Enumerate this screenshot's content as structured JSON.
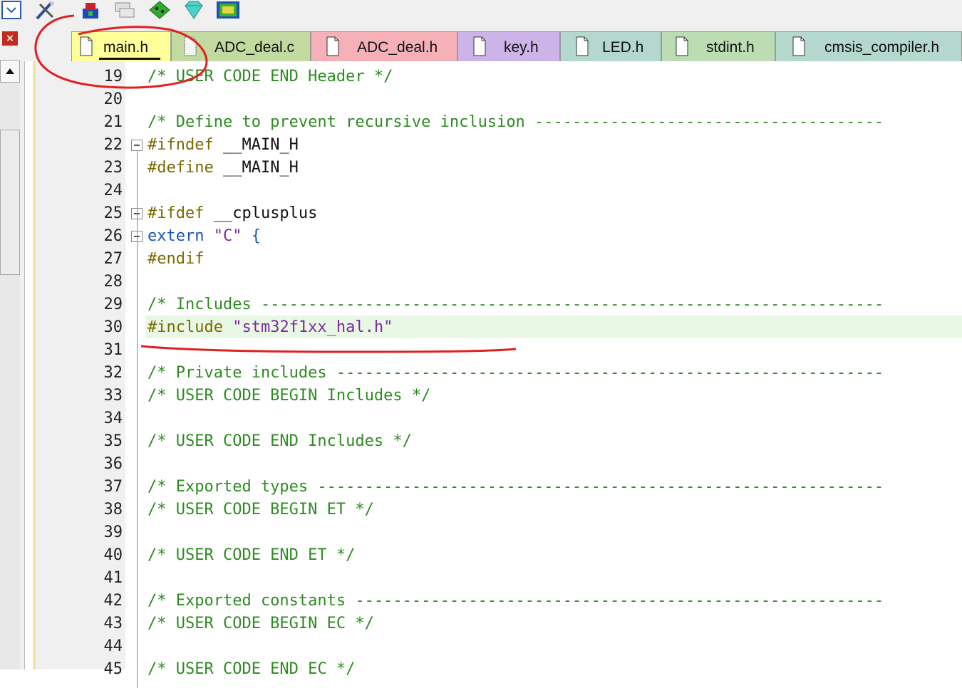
{
  "toolbar": {
    "icons": [
      "dropdown-arrow-icon",
      "magic-wand-icon",
      "build-target-icon",
      "stacked-windows-icon",
      "green-gem-icon",
      "diamond-icon",
      "chip-icon"
    ]
  },
  "left_pane": {
    "close_glyph": "×"
  },
  "tabs": [
    {
      "label": "main.h",
      "color": "#ffff99",
      "active": true
    },
    {
      "label": "ADC_deal.c",
      "color": "#c2d9a0"
    },
    {
      "label": "ADC_deal.h",
      "color": "#f5b0b8"
    },
    {
      "label": "key.h",
      "color": "#cdb4e8"
    },
    {
      "label": "LED.h",
      "color": "#b4d8cd"
    },
    {
      "label": "stdint.h",
      "color": "#bcdcb4"
    },
    {
      "label": "cmsis_compiler.h",
      "color": "#b4d8cd"
    }
  ],
  "editor": {
    "current_line": 30,
    "lines": [
      {
        "n": "19",
        "segs": [
          {
            "t": "/* USER CODE END Header */",
            "c": "comment"
          }
        ]
      },
      {
        "n": "20",
        "segs": []
      },
      {
        "n": "21",
        "segs": [
          {
            "t": "/* Define to prevent recursive inclusion -------------------------------------",
            "c": "comment"
          }
        ]
      },
      {
        "n": "22",
        "segs": [
          {
            "t": "#ifndef ",
            "c": "pre"
          },
          {
            "t": "__MAIN_H",
            "c": "plain"
          }
        ]
      },
      {
        "n": "23",
        "segs": [
          {
            "t": "#define ",
            "c": "pre"
          },
          {
            "t": "__MAIN_H",
            "c": "plain"
          }
        ]
      },
      {
        "n": "24",
        "segs": []
      },
      {
        "n": "25",
        "segs": [
          {
            "t": "#ifdef ",
            "c": "pre"
          },
          {
            "t": "__cplusplus",
            "c": "plain"
          }
        ]
      },
      {
        "n": "26",
        "segs": [
          {
            "t": "extern ",
            "c": "kw"
          },
          {
            "t": "\"C\" ",
            "c": "str"
          },
          {
            "t": "{",
            "c": "kw"
          }
        ]
      },
      {
        "n": "27",
        "segs": [
          {
            "t": "#endif",
            "c": "pre"
          }
        ]
      },
      {
        "n": "28",
        "segs": []
      },
      {
        "n": "29",
        "segs": [
          {
            "t": "/* Includes ------------------------------------------------------------------",
            "c": "comment"
          }
        ]
      },
      {
        "n": "30",
        "segs": [
          {
            "t": "#include ",
            "c": "pre"
          },
          {
            "t": "\"stm32f1xx_hal.h\"",
            "c": "str"
          }
        ]
      },
      {
        "n": "31",
        "segs": []
      },
      {
        "n": "32",
        "segs": [
          {
            "t": "/* Private includes ----------------------------------------------------------",
            "c": "comment"
          }
        ]
      },
      {
        "n": "33",
        "segs": [
          {
            "t": "/* USER CODE BEGIN Includes */",
            "c": "comment"
          }
        ]
      },
      {
        "n": "34",
        "segs": []
      },
      {
        "n": "35",
        "segs": [
          {
            "t": "/* USER CODE END Includes */",
            "c": "comment"
          }
        ]
      },
      {
        "n": "36",
        "segs": []
      },
      {
        "n": "37",
        "segs": [
          {
            "t": "/* Exported types ------------------------------------------------------------",
            "c": "comment"
          }
        ]
      },
      {
        "n": "38",
        "segs": [
          {
            "t": "/* USER CODE BEGIN ET */",
            "c": "comment"
          }
        ]
      },
      {
        "n": "39",
        "segs": []
      },
      {
        "n": "40",
        "segs": [
          {
            "t": "/* USER CODE END ET */",
            "c": "comment"
          }
        ]
      },
      {
        "n": "41",
        "segs": []
      },
      {
        "n": "42",
        "segs": [
          {
            "t": "/* Exported constants --------------------------------------------------------",
            "c": "comment"
          }
        ]
      },
      {
        "n": "43",
        "segs": [
          {
            "t": "/* USER CODE BEGIN EC */",
            "c": "comment"
          }
        ]
      },
      {
        "n": "44",
        "segs": []
      },
      {
        "n": "45",
        "segs": [
          {
            "t": "/* USER CODE END EC */",
            "c": "comment"
          }
        ]
      }
    ]
  },
  "annotation_color": "#e02020"
}
